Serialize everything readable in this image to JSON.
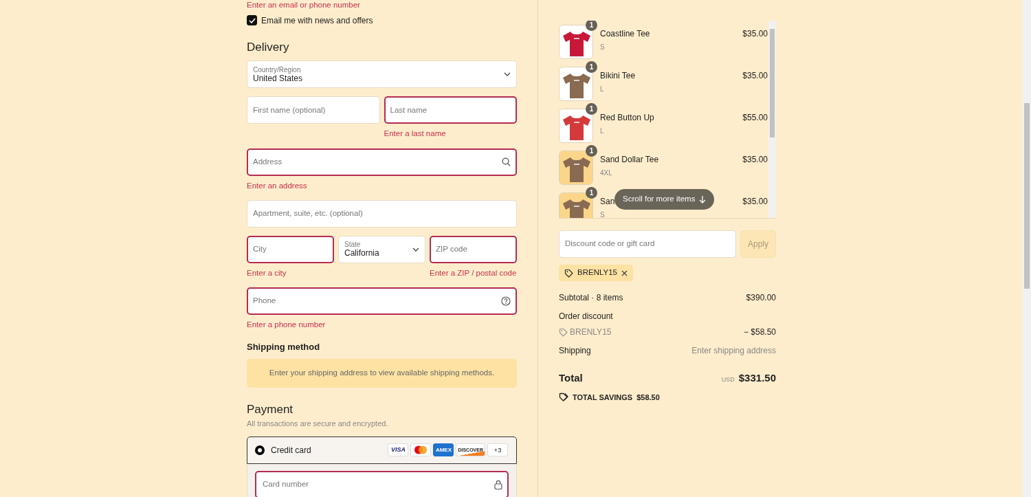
{
  "contact": {
    "error": "Enter an email or phone number",
    "newsletter": {
      "label": "Email me with news and offers",
      "checked": true
    }
  },
  "delivery": {
    "title": "Delivery",
    "rows": [
      [
        {
          "kind": "select",
          "label": "Country/Region",
          "value": "United States"
        }
      ],
      [
        {
          "kind": "input",
          "placeholder": "First name (optional)",
          "invalid": false
        },
        {
          "kind": "input",
          "placeholder": "Last name",
          "invalid": true,
          "error": "Enter a last name"
        }
      ],
      [
        {
          "kind": "search",
          "placeholder": "Address",
          "invalid": true,
          "error": "Enter an address"
        }
      ],
      [
        {
          "kind": "input",
          "placeholder": "Apartment, suite, etc. (optional)",
          "invalid": false
        }
      ],
      [
        {
          "kind": "input",
          "placeholder": "City",
          "invalid": true,
          "error": "Enter a city"
        },
        {
          "kind": "select",
          "label": "State",
          "value": "California"
        },
        {
          "kind": "input",
          "placeholder": "ZIP code",
          "invalid": true,
          "error": "Enter a ZIP / postal code"
        }
      ],
      [
        {
          "kind": "phone",
          "placeholder": "Phone",
          "invalid": true,
          "error": "Enter a phone number"
        }
      ]
    ]
  },
  "shipping": {
    "title": "Shipping method",
    "notice": "Enter your shipping address to view available shipping methods."
  },
  "payment": {
    "title": "Payment",
    "subtitle": "All transactions are secure and encrypted.",
    "methods": [
      {
        "label": "Credit card",
        "selected": true,
        "brands": [
          {
            "kind": "visa",
            "label": "VISA"
          },
          {
            "kind": "mastercard"
          },
          {
            "kind": "amex",
            "label": "AMEX"
          },
          {
            "kind": "discover",
            "label": "DISCOVER"
          }
        ],
        "more": "+3"
      }
    ],
    "card_fields": [
      {
        "kind": "card",
        "placeholder": "Card number",
        "invalid": true
      }
    ]
  },
  "order": {
    "items": [
      {
        "name": "Coastline Tee",
        "variant": "S",
        "price": "$35.00",
        "quantity": "1"
      },
      {
        "name": "Bikini Tee",
        "variant": "L",
        "price": "$35.00",
        "quantity": "1"
      },
      {
        "name": "Red Button Up",
        "variant": "L",
        "price": "$55.00",
        "quantity": "1"
      },
      {
        "name": "Sand Dollar Tee",
        "variant": "4XL",
        "price": "$35.00",
        "quantity": "1"
      },
      {
        "name": "San",
        "variant": "S",
        "price": "$35.00",
        "quantity": "1"
      }
    ],
    "scroll_hint": "Scroll for more items",
    "discount": {
      "placeholder": "Discount code or gift card",
      "button": "Apply",
      "disabled": true
    },
    "applied_codes": [
      "BRENLY15"
    ],
    "summary": {
      "subtotal_label": "Subtotal · 8 items",
      "subtotal": "$390.00",
      "discount_label": "Order discount",
      "discount_code": "BRENLY15",
      "discount_amount": "− $58.50",
      "shipping_label": "Shipping",
      "shipping_value": "Enter shipping address",
      "total_label": "Total",
      "currency": "USD",
      "total": "$331.50",
      "savings_label": "TOTAL SAVINGS",
      "savings": "$58.50"
    }
  }
}
